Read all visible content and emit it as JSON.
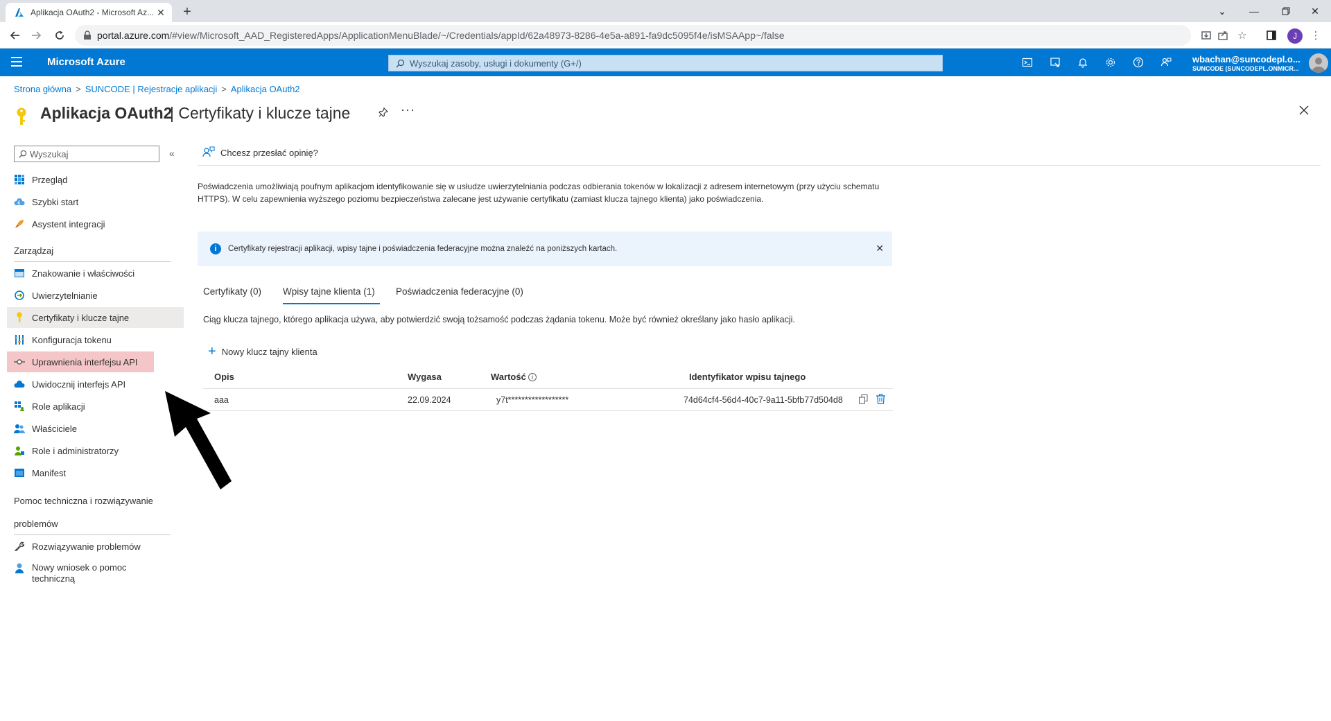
{
  "browser": {
    "tab_title": "Aplikacja OAuth2 - Microsoft Az...",
    "url_host": "portal.azure.com",
    "url_rest": "/#view/Microsoft_AAD_RegisteredApps/ApplicationMenuBlade/~/Credentials/appId/62a48973-8286-4e5a-a891-fa9dc5095f4e/isMSAApp~/false",
    "profile_initial": "J"
  },
  "azure": {
    "brand": "Microsoft Azure",
    "search_placeholder": "Wyszukaj zasoby, usługi i dokumenty (G+/)",
    "user_email": "wbachan@suncodepl.o...",
    "user_tenant": "SUNCODE (SUNCODEPL.ONMICR..."
  },
  "breadcrumb": [
    "Strona główna",
    "SUNCODE | Rejestracje aplikacji",
    "Aplikacja OAuth2"
  ],
  "title": {
    "main": "Aplikacja OAuth2",
    "sub": "| Certyfikaty i klucze tajne"
  },
  "leftnav": {
    "search_placeholder": "Wyszukaj",
    "collapse": "«",
    "top_items": [
      "Przegląd",
      "Szybki start",
      "Asystent integracji"
    ],
    "section_manage": "Zarządzaj",
    "manage_items": [
      "Znakowanie i właściwości",
      "Uwierzytelnianie",
      "Certyfikaty i klucze tajne",
      "Konfiguracja tokenu",
      "Uprawnienia interfejsu API",
      "Uwidocznij interfejs API",
      "Role aplikacji",
      "Właściciele",
      "Role i administratorzy",
      "Manifest"
    ],
    "section_support_1": "Pomoc techniczna i rozwiązywanie",
    "section_support_2": "problemów",
    "support_items": [
      "Rozwiązywanie problemów",
      "Nowy wniosek o pomoc",
      "techniczną"
    ]
  },
  "main": {
    "feedback": "Chcesz przesłać opinię?",
    "description": "Poświadczenia umożliwiają poufnym aplikacjom identyfikowanie się w usłudze uwierzytelniania podczas odbierania tokenów w lokalizacji z adresem internetowym (przy użyciu schematu HTTPS). W celu zapewnienia wyższego poziomu bezpieczeństwa zalecane jest używanie certyfikatu (zamiast klucza tajnego klienta) jako poświadczenia.",
    "info_text": "Certyfikaty rejestracji aplikacji, wpisy tajne i poświadczenia federacyjne można znaleźć na poniższych kartach.",
    "tabs": [
      "Certyfikaty (0)",
      "Wpisy tajne klienta (1)",
      "Poświadczenia federacyjne (0)"
    ],
    "selected_tab": 1,
    "tab_description": "Ciąg klucza tajnego, którego aplikacja używa, aby potwierdzić swoją tożsamość podczas żądania tokenu. Może być również określany jako hasło aplikacji.",
    "new_secret": "Nowy klucz tajny klienta",
    "table": {
      "headers": [
        "Opis",
        "Wygasa",
        "Wartość",
        "Identyfikator wpisu tajnego"
      ],
      "rows": [
        {
          "opis": "aaa",
          "wygasa": "22.09.2024",
          "wartosc": "y7t******************",
          "id": "74d64cf4-56d4-40c7-9a11-5bfb77d504d8"
        }
      ]
    }
  },
  "colors": {
    "azure_blue": "#0078d4",
    "highlight_red": "#f4c6c8",
    "active_nav": "#edebe9",
    "info_bg": "#ebf3fc"
  }
}
